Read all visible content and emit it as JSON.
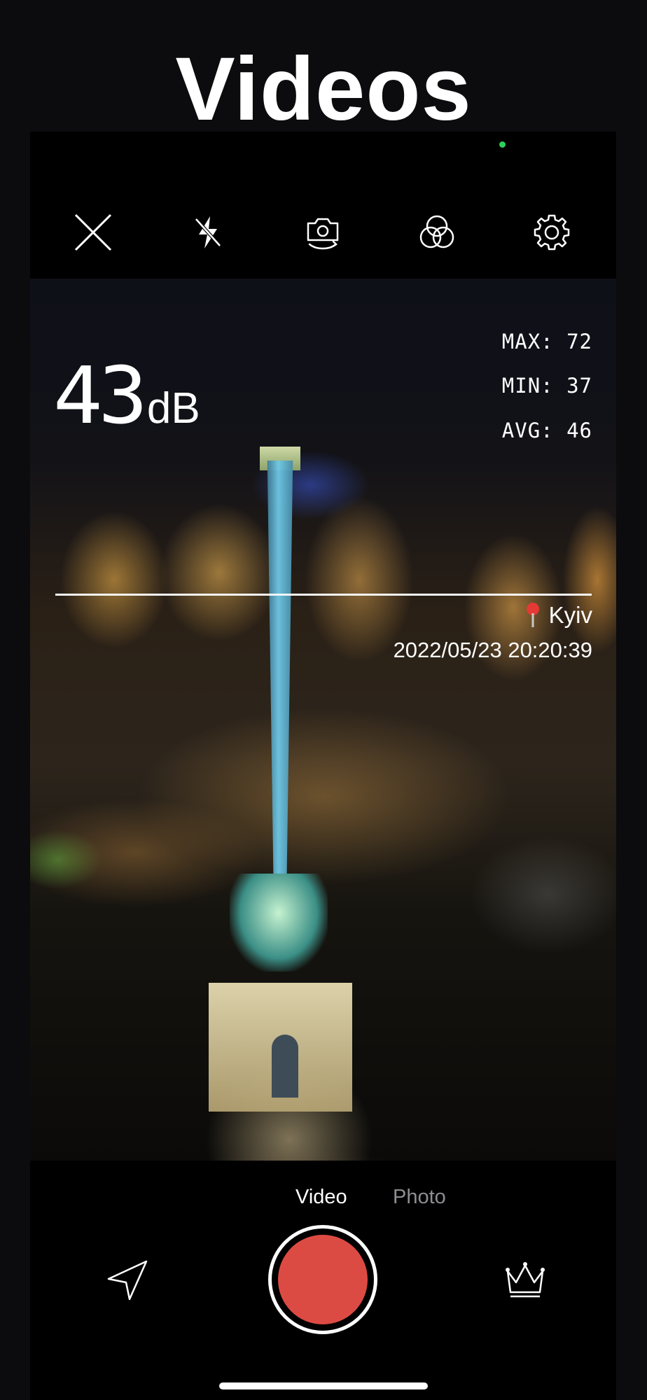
{
  "headline": "Videos",
  "toolbar": {
    "items": [
      {
        "icon": "close-icon"
      },
      {
        "icon": "flash-off-icon"
      },
      {
        "icon": "camera-switch-icon"
      },
      {
        "icon": "filters-icon"
      },
      {
        "icon": "gear-icon"
      }
    ]
  },
  "meter": {
    "value": "43",
    "unit": "dB",
    "max": "MAX: 72",
    "min": "MIN: 37",
    "avg": "AVG: 46"
  },
  "overlay": {
    "location": "Kyiv",
    "timestamp": "2022/05/23 20:20:39"
  },
  "modes": {
    "video": "Video",
    "photo": "Photo",
    "active": "Video"
  },
  "colors": {
    "shutter": "#dc4b43",
    "active_mode": "#ffffff",
    "inactive_mode": "#8e8e93",
    "pin": "#e53935",
    "status_dot": "#2fd05a"
  }
}
